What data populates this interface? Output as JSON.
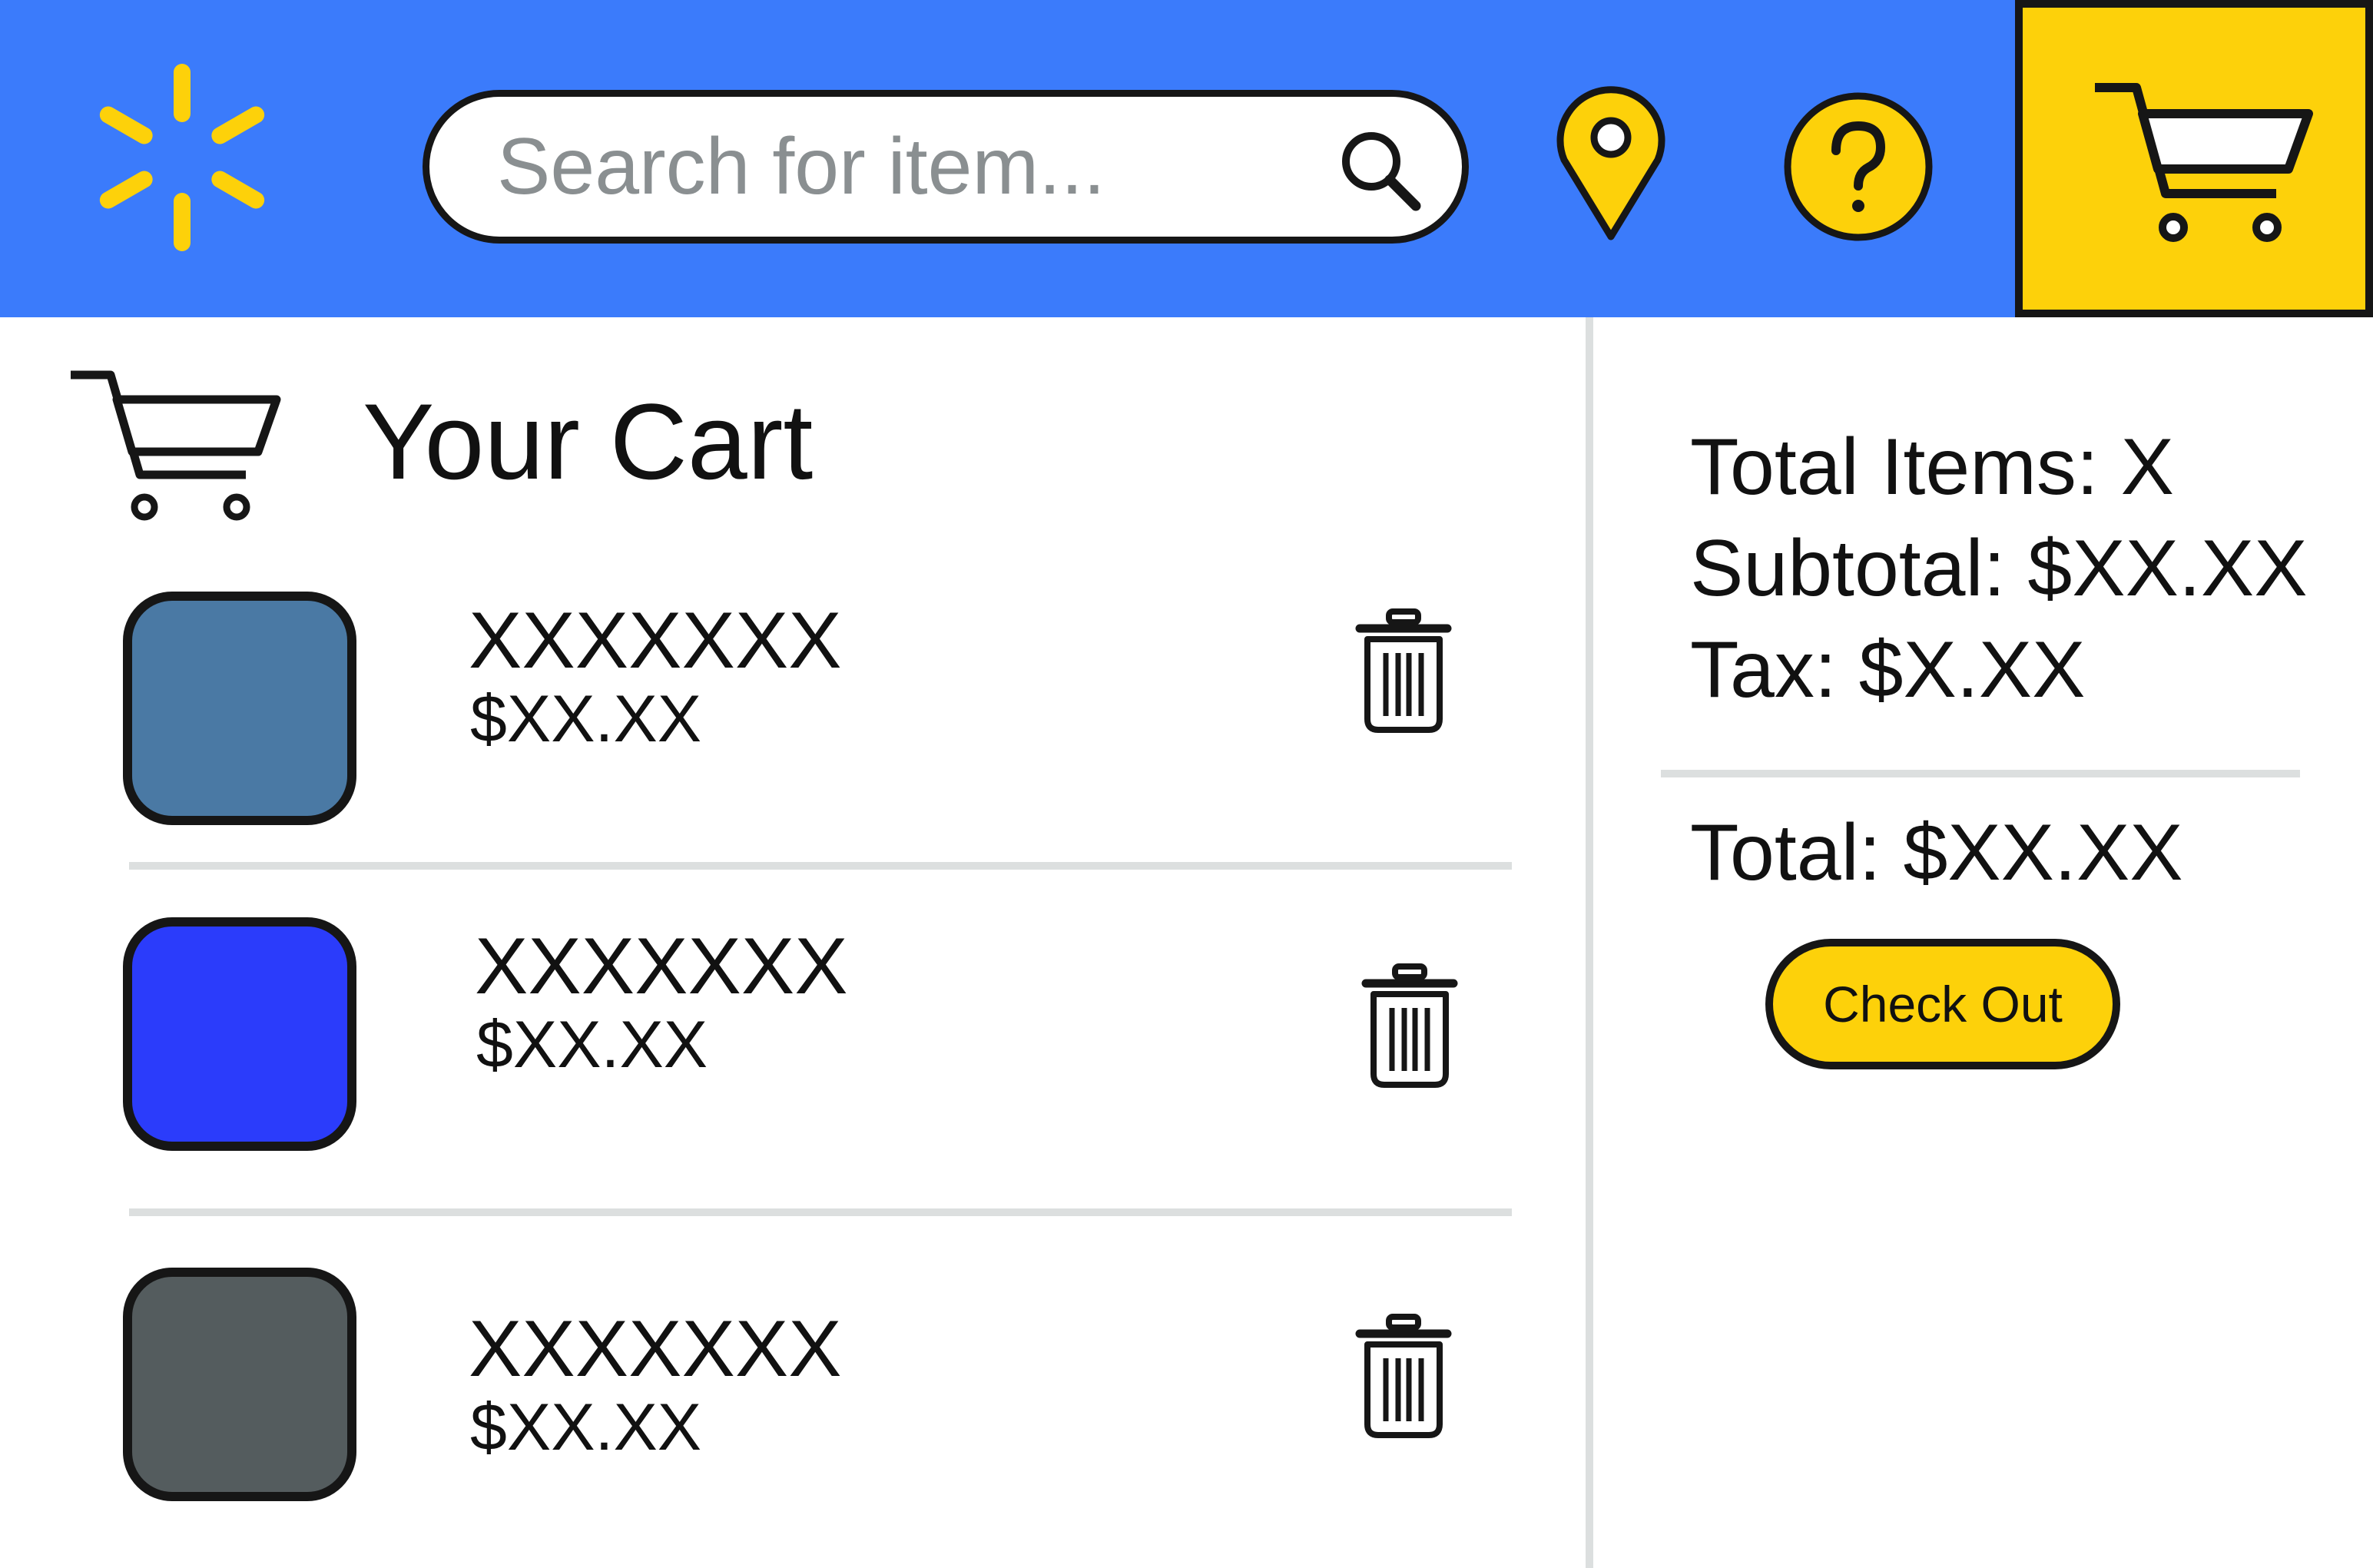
{
  "colors": {
    "header_bg": "#3b7bfb",
    "accent_yellow": "#fdd10a",
    "outline": "#161616",
    "divider": "#dcdfdf",
    "placeholder_text": "#8a8f91"
  },
  "header": {
    "logo_icon": "spark-logo-icon",
    "search": {
      "value": "",
      "placeholder": "Search for item...",
      "icon": "search-icon"
    },
    "location_icon": "location-pin-icon",
    "help_icon": "help-icon",
    "cart_icon": "cart-icon"
  },
  "cart": {
    "title": "Your Cart",
    "title_icon": "cart-icon",
    "items": [
      {
        "name": "XXXXXXX",
        "price": "$XX.XX",
        "thumb_color": "#4a79a4",
        "icon": "trash-icon"
      },
      {
        "name": "XXXXXXX",
        "price": "$XX.XX",
        "thumb_color": "#2b3cfb",
        "icon": "trash-icon"
      },
      {
        "name": "XXXXXXX",
        "price": "$XX.XX",
        "thumb_color": "#545c5e",
        "icon": "trash-icon"
      }
    ]
  },
  "summary": {
    "total_items": "Total Items: X",
    "subtotal": "Subtotal: $XX.XX",
    "tax": "Tax: $X.XX",
    "total": "Total: $XX.XX",
    "checkout_label": "Check Out"
  }
}
